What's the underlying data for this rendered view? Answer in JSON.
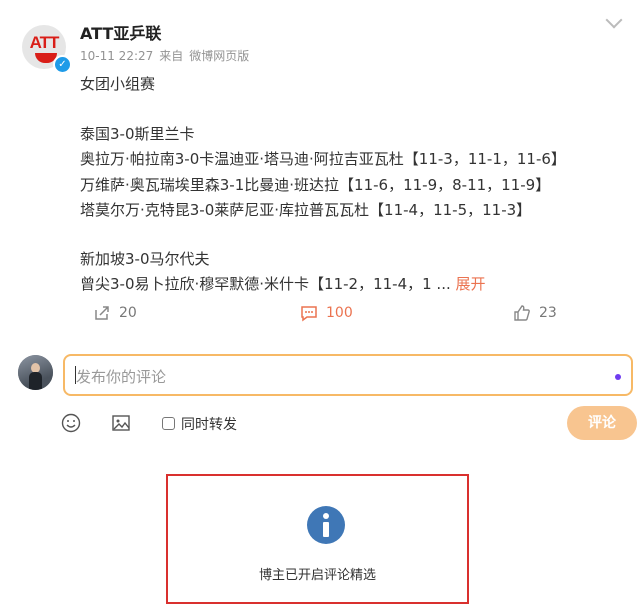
{
  "post": {
    "author": "ATT亚乒联",
    "avatar_text": "ATT",
    "timestamp": "10-11 22:27",
    "source_prefix": "来自",
    "source": "微博网页版",
    "lines": [
      "女团小组赛",
      "泰国3-0斯里兰卡",
      "奥拉万·帕拉南3-0卡温迪亚·塔马迪·阿拉吉亚瓦杜【11-3，11-1，11-6】",
      "万维萨·奥瓦瑞埃里森3-1比曼迪·班达拉【11-6，11-9，8-11，11-9】",
      "塔莫尔万·克特昆3-0莱萨尼亚·库拉普瓦瓦杜【11-4，11-5，11-3】",
      "新加坡3-0马尔代夫",
      "曾尖3-0易卜拉欣·穆罕默德·米什卡【11-2，11-4，1 ..."
    ],
    "expand_label": "展开"
  },
  "actions": {
    "repost_count": "20",
    "comment_count": "100",
    "like_count": "23"
  },
  "comment": {
    "placeholder": "发布你的评论",
    "repost_label": "同时转发",
    "submit_label": "评论"
  },
  "notice": {
    "text": "博主已开启评论精选"
  },
  "colors": {
    "accent": "#eb7350",
    "input_border": "#f7b966",
    "submit_bg": "#f8c590",
    "notice_border": "#d9302e",
    "info_icon": "#3f77b6",
    "verified": "#1f9be8"
  }
}
